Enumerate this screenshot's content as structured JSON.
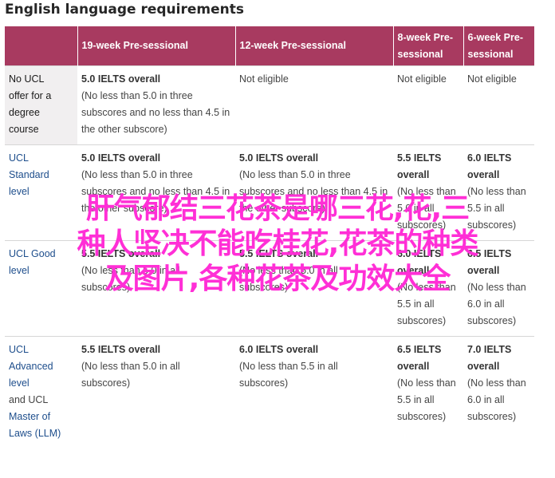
{
  "title": "English language requirements",
  "table": {
    "headers": [
      "",
      "19-week Pre-sessional",
      "12-week Pre-sessional",
      "8-week Pre-sessional",
      "6-week Pre-sessional"
    ],
    "rows": [
      {
        "label": [
          "No UCL",
          "offer for a",
          "degree",
          "course"
        ],
        "label_link": false,
        "cells": [
          {
            "main": "5.0 IELTS overall",
            "note": "(No less than 5.0 in three subscores and no less than 4.5 in the other subscore)"
          },
          {
            "main": "",
            "note": "Not eligible"
          },
          {
            "main": "",
            "note": "Not eligible"
          },
          {
            "main": "",
            "note": "Not eligible"
          }
        ]
      },
      {
        "label": [
          "UCL",
          "Standard",
          "level"
        ],
        "label_link": true,
        "cells": [
          {
            "main": "5.0 IELTS overall",
            "note": "(No less than 5.0 in three subscores and no less than 4.5 in the other subscore)"
          },
          {
            "main": "5.0 IELTS overall",
            "note": "(No less than 5.0 in three subscores and no less than 4.5 in the other subscore)"
          },
          {
            "main": "5.5 IELTS overall",
            "note": "(No less than 5.0 in all subscores)"
          },
          {
            "main": "6.0 IELTS overall",
            "note": "(No less than 5.5 in all subscores)"
          }
        ]
      },
      {
        "label": [
          "UCL Good",
          "level"
        ],
        "label_link": true,
        "cells": [
          {
            "main": "5.5 IELTS overall",
            "note": "(No less than 5.0 in all subscores)"
          },
          {
            "main": "5.5 IELTS overall",
            "note": "(No less than 5.0 in all subscores)"
          },
          {
            "main": "6.0 IELTS overall",
            "note": "(No less than 5.5 in all subscores)"
          },
          {
            "main": "6.5 IELTS overall",
            "note": "(No less than 6.0 in all subscores)"
          }
        ]
      },
      {
        "label": [
          "UCL",
          "Advanced",
          "level",
          "and UCL",
          "Master of",
          "Laws (LLM)"
        ],
        "label_link": true,
        "cells": [
          {
            "main": "5.5 IELTS overall",
            "note": "(No less than 5.0 in all subscores)"
          },
          {
            "main": "6.0 IELTS overall",
            "note": "(No less than 5.5 in all subscores)"
          },
          {
            "main": "6.5 IELTS overall",
            "note": "(No less than 5.5 in all subscores)"
          },
          {
            "main": "7.0 IELTS overall",
            "note": "(No less than 6.0 in all subscores)"
          }
        ]
      }
    ]
  },
  "overlay_text": {
    "line1": "肝气郁结三花茶是哪三花,花,三",
    "line2": "种人坚决不能吃桂花,花茶的种类",
    "line3": "及图片,各种花茶及功效大全"
  }
}
